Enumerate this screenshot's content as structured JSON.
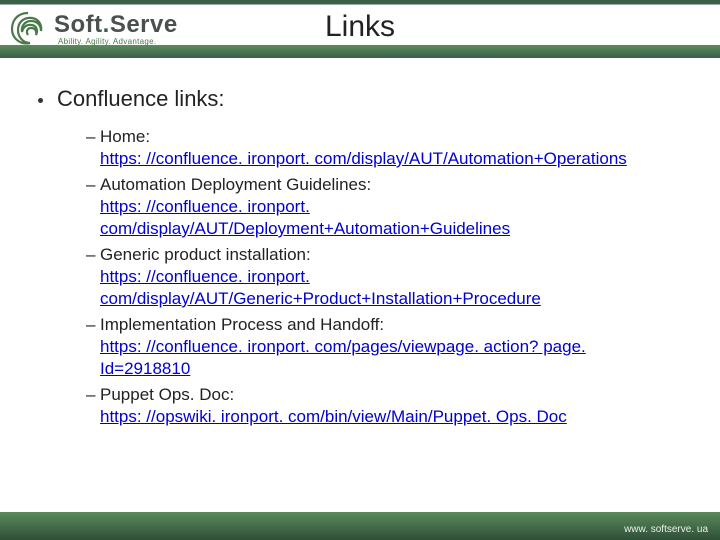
{
  "brand": {
    "name_a": "Soft",
    "dot": ".",
    "name_b": "Serve",
    "tagline": "Ability. Agility. Advantage."
  },
  "title": "Links",
  "bullet_heading": "Confluence links:",
  "items": [
    {
      "label": "Home:",
      "url": "https: //confluence. ironport. com/display/AUT/Automation+Operations"
    },
    {
      "label": "Automation Deployment Guidelines:",
      "url": "https: //confluence. ironport. com/display/AUT/Deployment+Automation+Guidelines"
    },
    {
      "label": "Generic product installation:",
      "url": "https: //confluence. ironport. com/display/AUT/Generic+Product+Installation+Procedure"
    },
    {
      "label": "Implementation Process and Handoff:",
      "url": "https: //confluence. ironport. com/pages/viewpage. action? page. Id=2918810"
    },
    {
      "label": "Puppet Ops. Doc:",
      "url": "https: //opswiki. ironport. com/bin/view/Main/Puppet. Ops. Doc"
    }
  ],
  "footer_url": "www. softserve. ua"
}
